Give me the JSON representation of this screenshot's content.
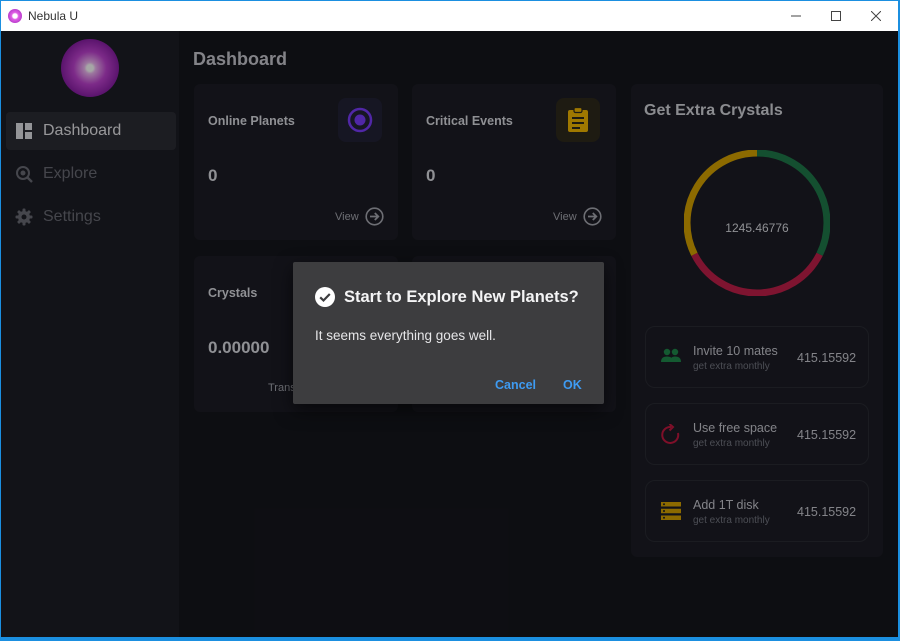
{
  "window": {
    "title": "Nebula U"
  },
  "sidebar": {
    "items": [
      {
        "label": "Dashboard",
        "icon": "dashboard-icon",
        "active": true
      },
      {
        "label": "Explore",
        "icon": "explore-icon",
        "active": false
      },
      {
        "label": "Settings",
        "icon": "gear-icon",
        "active": false
      }
    ]
  },
  "main": {
    "title": "Dashboard",
    "cards": [
      {
        "title": "Online Planets",
        "value": "0",
        "link": "View",
        "icon": "target-icon",
        "accent": "#7b3cff"
      },
      {
        "title": "Critical Events",
        "value": "0",
        "link": "View",
        "icon": "clipboard-icon",
        "accent": "#f5b800"
      },
      {
        "title": "Crystals",
        "value": "0.00000",
        "link": "Trans"
      }
    ]
  },
  "extra": {
    "title": "Get Extra Crystals",
    "total": "1245.46776",
    "ring_colors": [
      "#1f7a4a",
      "#c21f4b",
      "#d8a300"
    ],
    "items": [
      {
        "title": "Invite 10 mates",
        "sub": "get extra monthly",
        "value": "415.15592",
        "icon": "group-icon",
        "color": "#1f8a4c"
      },
      {
        "title": "Use free space",
        "sub": "get extra monthly",
        "value": "415.15592",
        "icon": "refresh-icon",
        "color": "#c2183f"
      },
      {
        "title": "Add 1T disk",
        "sub": "get extra monthly",
        "value": "415.15592",
        "icon": "storage-icon",
        "color": "#d8a300"
      }
    ]
  },
  "dialog": {
    "title": "Start to Explore New Planets?",
    "body": "It seems everything goes well.",
    "cancel": "Cancel",
    "ok": "OK"
  }
}
